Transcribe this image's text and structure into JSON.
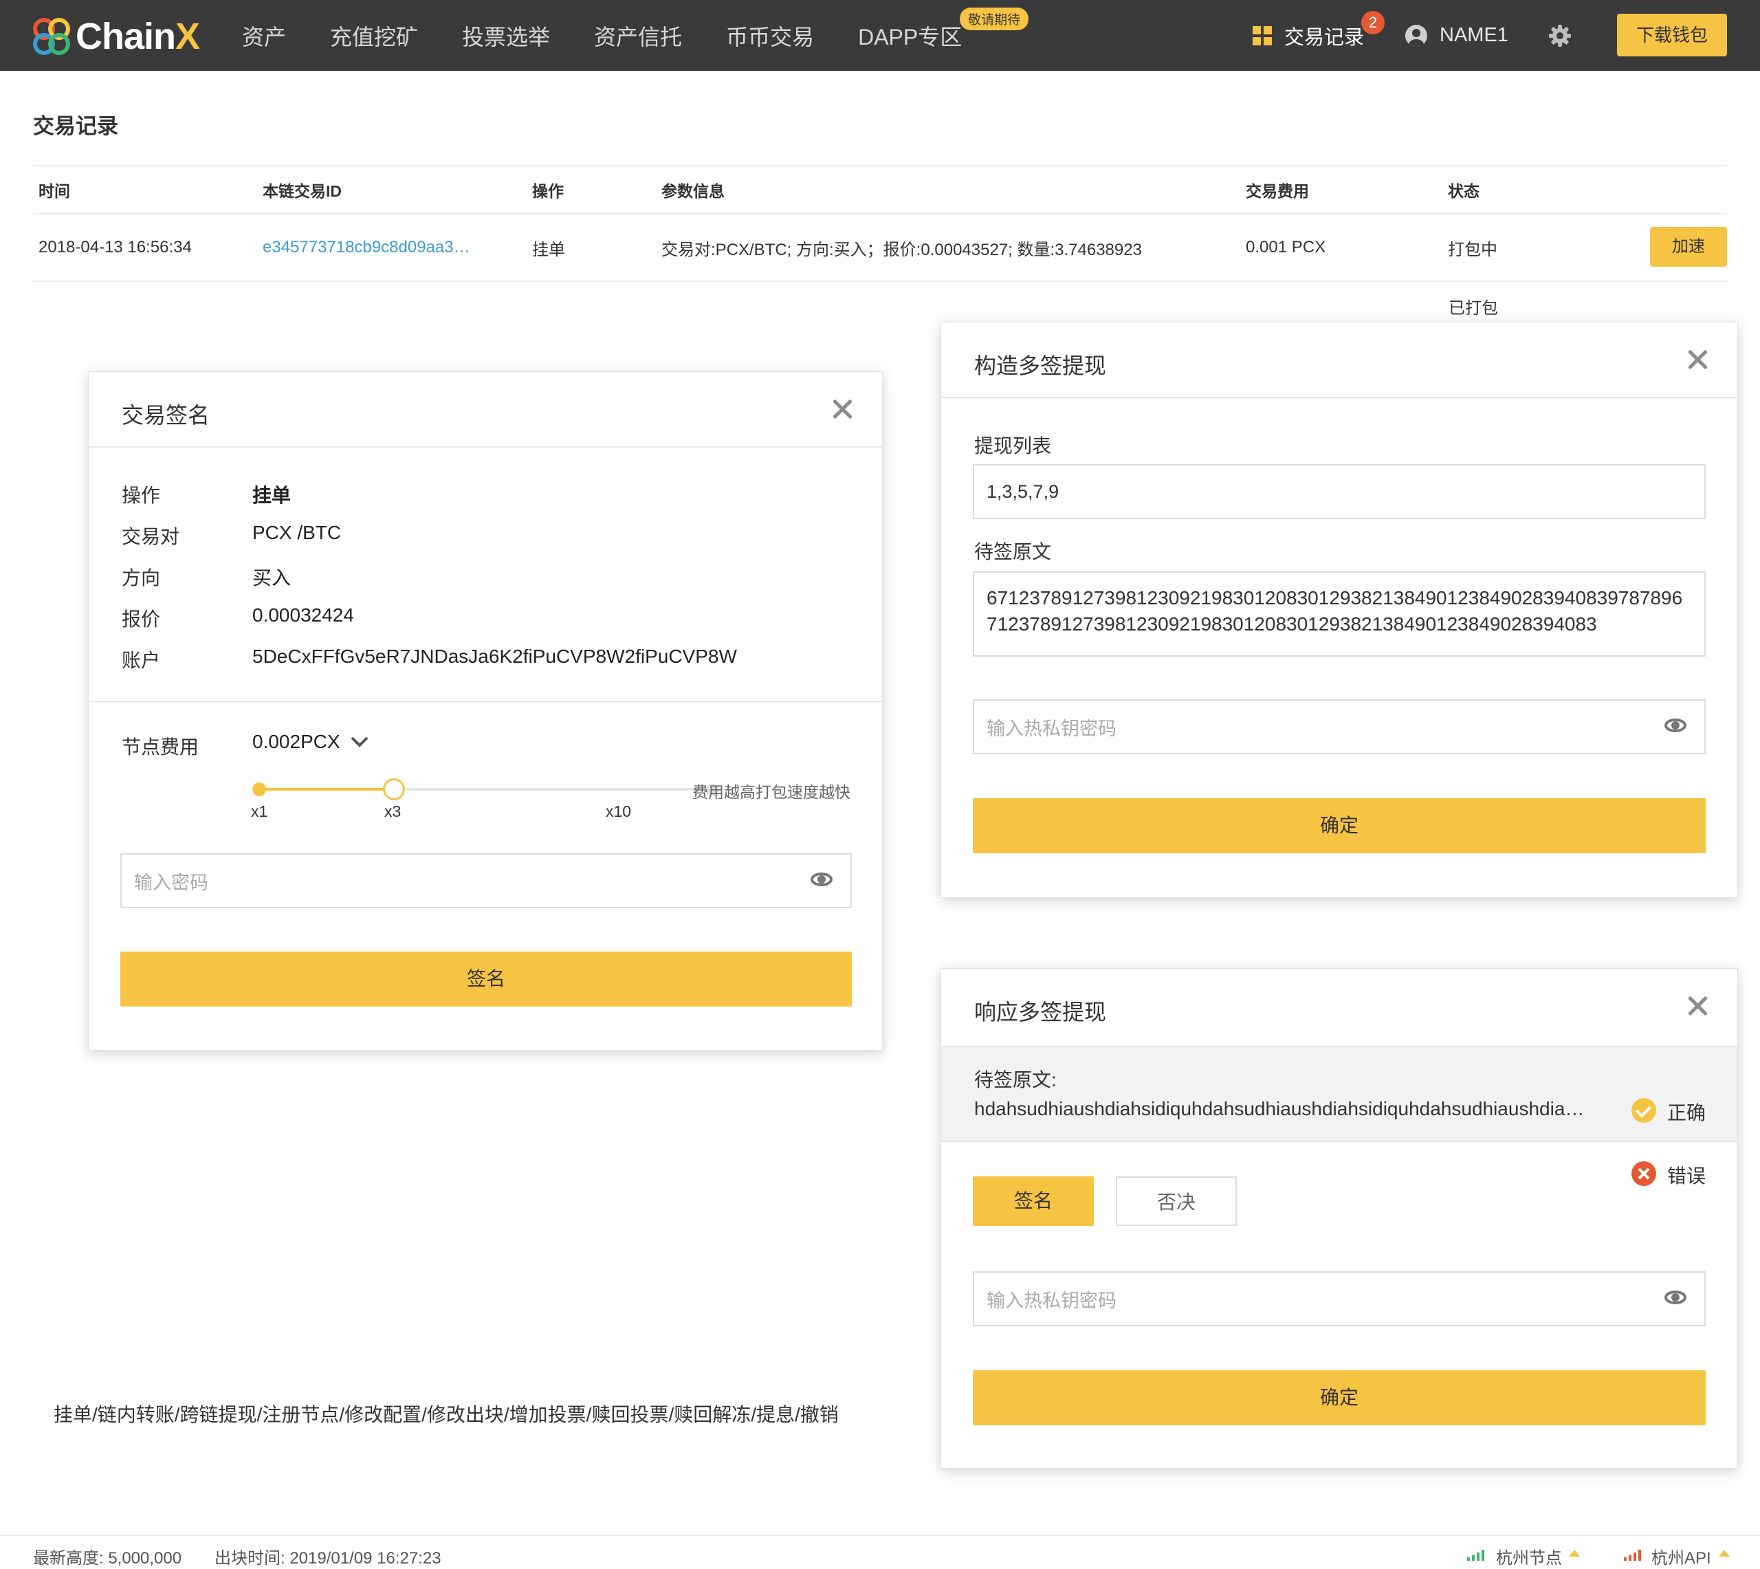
{
  "header": {
    "logo_text_main": "Chain",
    "logo_text_accent": "X",
    "nav": [
      "资产",
      "充值挖矿",
      "投票选举",
      "资产信托",
      "币币交易",
      "DAPP专区"
    ],
    "dapp_badge": "敬请期待",
    "tx_records_label": "交易记录",
    "tx_records_count": "2",
    "user_name": "NAME1",
    "download_label": "下载钱包"
  },
  "page": {
    "title": "交易记录"
  },
  "table": {
    "headers": [
      "时间",
      "本链交易ID",
      "操作",
      "参数信息",
      "交易费用",
      "状态"
    ],
    "row": {
      "time": "2018-04-13 16:56:34",
      "tx_id": "e345773718cb9c8d09aa3…",
      "op": "挂单",
      "params": "交易对:PCX/BTC; 方向:买入；报价:0.00043527; 数量:3.74638923",
      "fee": "0.001 PCX",
      "status": "打包中",
      "accel_label": "加速"
    },
    "status_alt": "已打包"
  },
  "sign_modal": {
    "title": "交易签名",
    "fields": [
      {
        "label": "操作",
        "value": "挂单"
      },
      {
        "label": "交易对",
        "value": "PCX /BTC"
      },
      {
        "label": "方向",
        "value": "买入"
      },
      {
        "label": "报价",
        "value": "0.00032424"
      },
      {
        "label": "账户",
        "value": "5DeCxFFfGv5eR7JNDasJa6K2ﬁPuCVP8W2ﬁPuCVP8W"
      }
    ],
    "fee_label": "节点费用",
    "fee_value": "0.002PCX",
    "slider_ticks": [
      "x1",
      "x3",
      "x10"
    ],
    "slider_hint": "费用越高打包速度越快",
    "password_placeholder": "输入密码",
    "submit_label": "签名"
  },
  "build_modal": {
    "title": "构造多签提现",
    "list_label": "提现列表",
    "list_value": "1,3,5,7,9",
    "raw_label": "待签原文",
    "raw_value": "67123789127398123092198301208301293821384901238490283940839787896712378912739812309219830120830129382138490123849028394083",
    "password_placeholder": "输入热私钥密码",
    "confirm_label": "确定"
  },
  "respond_modal": {
    "title": "响应多签提现",
    "raw_label": "待签原文:",
    "raw_value": "hdahsudhiaushdiahsidiquhdahsudhiaushdiahsidiquhdahsudhiaushdia…",
    "ok_label": "正确",
    "err_label": "错误",
    "sign_label": "签名",
    "reject_label": "否决",
    "password_placeholder": "输入热私钥密码",
    "confirm_label": "确定"
  },
  "ops_list": "挂单/链内转账/跨链提现/注册节点/修改配置/修改出块/增加投票/赎回投票/赎回解冻/提息/撤销",
  "footer": {
    "height_text": "最新高度: 5,000,000",
    "time_text": "出块时间: 2019/01/09 16:27:23",
    "node_label": "杭州节点",
    "api_label": "杭州API"
  },
  "colors": {
    "accent": "#f6c343",
    "header_bg": "#3a3a3a",
    "link": "#3b9bd4",
    "error": "#e55934",
    "signal_green": "#3cb371"
  }
}
